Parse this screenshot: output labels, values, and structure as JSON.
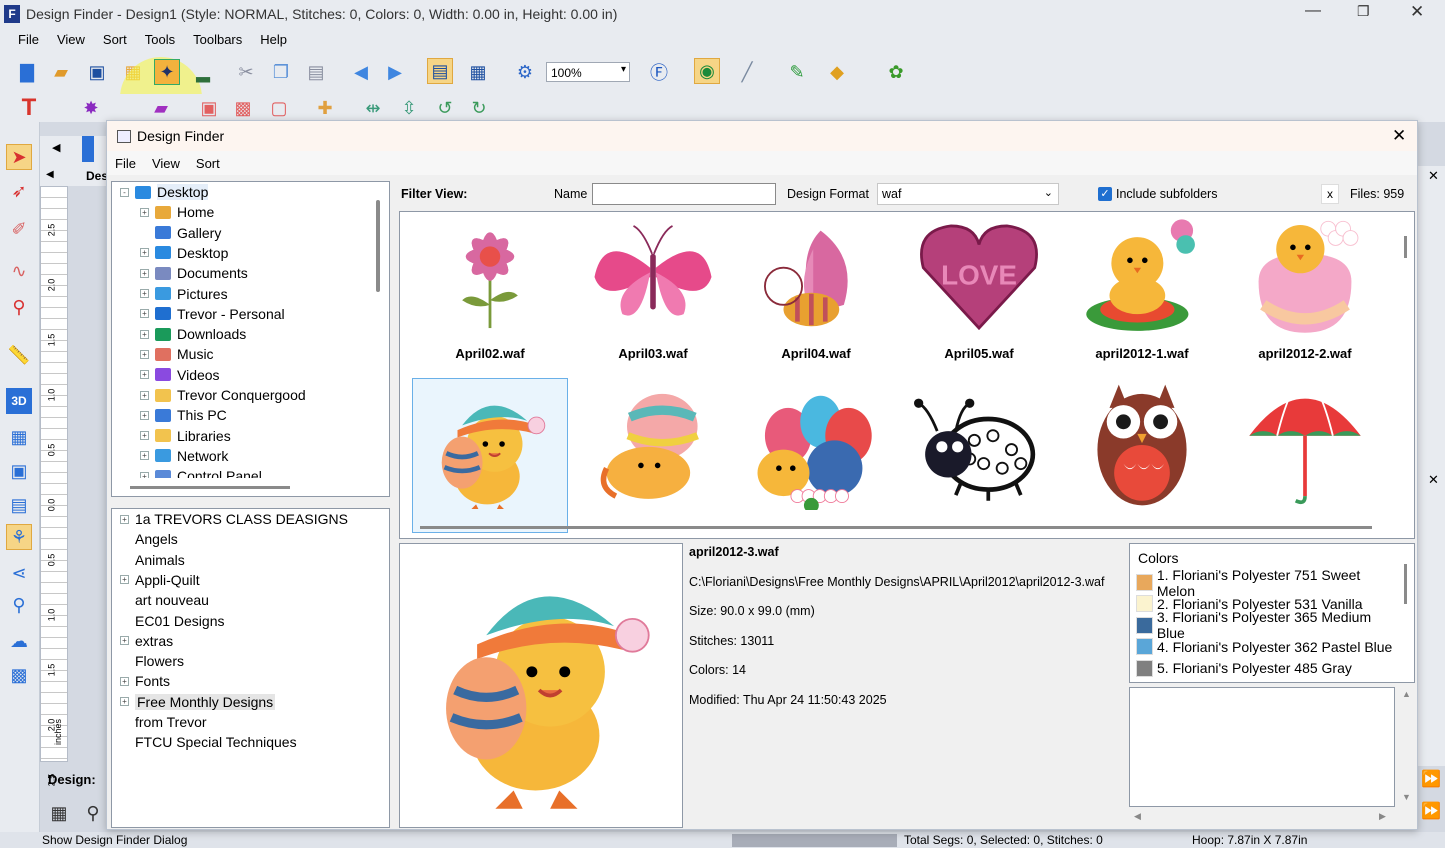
{
  "app": {
    "title": "Design Finder - Design1 (Style: NORMAL, Stitches: 0, Colors: 0, Width: 0.00 in, Height: 0.00 in)",
    "menu": [
      "File",
      "View",
      "Sort",
      "Tools",
      "Toolbars",
      "Help"
    ],
    "zoom": "100%",
    "design_label": "Design:",
    "tab_label": "Des",
    "status": {
      "left": "Show Design Finder Dialog",
      "middle": "Total Segs: 0, Selected: 0, Stitches: 0",
      "right": "Hoop: 7.87in X 7.87in"
    },
    "ruler": {
      "unit": "inches",
      "ticks": [
        "2.5",
        "2.0",
        "1.5",
        "1.0",
        "0.5",
        "0.0",
        "0.5",
        "1.0",
        "1.5",
        "2.0",
        "2.5"
      ]
    }
  },
  "dialog": {
    "title": "Design Finder",
    "menu": [
      "File",
      "View",
      "Sort"
    ],
    "filter": {
      "label": "Filter View:",
      "name_label": "Name",
      "name_value": "",
      "format_label": "Design Format",
      "format_value": "waf",
      "include_subfolders": "Include subfolders",
      "clear": "x",
      "files_count": "Files: 959"
    },
    "tree": [
      {
        "label": "Desktop",
        "level": 0,
        "expander": "-",
        "icon": "desktop-icon"
      },
      {
        "label": "Home",
        "level": 1,
        "expander": "+",
        "icon": "home-icon"
      },
      {
        "label": "Gallery",
        "level": 1,
        "expander": "",
        "icon": "gallery-icon"
      },
      {
        "label": "Desktop",
        "level": 1,
        "expander": "+",
        "icon": "desktop-icon"
      },
      {
        "label": "Documents",
        "level": 1,
        "expander": "+",
        "icon": "documents-icon"
      },
      {
        "label": "Pictures",
        "level": 1,
        "expander": "+",
        "icon": "pictures-icon"
      },
      {
        "label": "Trevor - Personal",
        "level": 1,
        "expander": "+",
        "icon": "cloud-icon"
      },
      {
        "label": "Downloads",
        "level": 1,
        "expander": "+",
        "icon": "downloads-icon"
      },
      {
        "label": "Music",
        "level": 1,
        "expander": "+",
        "icon": "music-icon"
      },
      {
        "label": "Videos",
        "level": 1,
        "expander": "+",
        "icon": "videos-icon"
      },
      {
        "label": "Trevor Conquergood",
        "level": 1,
        "expander": "+",
        "icon": "folder-icon"
      },
      {
        "label": "This PC",
        "level": 1,
        "expander": "+",
        "icon": "pc-icon"
      },
      {
        "label": "Libraries",
        "level": 1,
        "expander": "+",
        "icon": "folder-icon"
      },
      {
        "label": "Network",
        "level": 1,
        "expander": "+",
        "icon": "network-icon"
      },
      {
        "label": "Control Panel",
        "level": 1,
        "expander": "+",
        "icon": "control-panel-icon"
      }
    ],
    "folders": [
      {
        "label": "1a TREVORS CLASS DEASIGNS",
        "expander": "+"
      },
      {
        "label": "Angels",
        "expander": ""
      },
      {
        "label": "Animals",
        "expander": ""
      },
      {
        "label": "Appli-Quilt",
        "expander": "+"
      },
      {
        "label": "art nouveau",
        "expander": ""
      },
      {
        "label": "EC01 Designs",
        "expander": ""
      },
      {
        "label": "extras",
        "expander": "+"
      },
      {
        "label": "Flowers",
        "expander": ""
      },
      {
        "label": "Fonts",
        "expander": "+"
      },
      {
        "label": "Free Monthly Designs",
        "expander": "+",
        "selected": true
      },
      {
        "label": "from Trevor",
        "expander": ""
      },
      {
        "label": "FTCU Special Techniques",
        "expander": ""
      }
    ],
    "thumbnails": [
      {
        "name": "April02.waf",
        "art": "flower"
      },
      {
        "name": "April03.waf",
        "art": "butterfly"
      },
      {
        "name": "April04.waf",
        "art": "bee"
      },
      {
        "name": "April05.waf",
        "art": "heart"
      },
      {
        "name": "april2012-1.waf",
        "art": "chick-nest"
      },
      {
        "name": "april2012-2.waf",
        "art": "chick-egg"
      },
      {
        "name": "",
        "art": "chick-hat",
        "selected": true
      },
      {
        "name": "",
        "art": "chick-egg2"
      },
      {
        "name": "",
        "art": "eggs"
      },
      {
        "name": "",
        "art": "ladybug"
      },
      {
        "name": "",
        "art": "owl"
      },
      {
        "name": "",
        "art": "umbrella"
      }
    ],
    "details": {
      "filename": "april2012-3.waf",
      "path": "C:\\Floriani\\Designs\\Free Monthly Designs\\APRIL\\April2012\\april2012-3.waf",
      "size": "Size: 90.0 x 99.0 (mm)",
      "stitches": "Stitches: 13011",
      "colors": "Colors: 14",
      "modified": "Modified: Thu Apr 24 11:50:43 2025"
    },
    "colors_title": "Colors",
    "colors": [
      {
        "label": "1. Floriani's Polyester 751 Sweet Melon",
        "hex": "#e8a85c"
      },
      {
        "label": "2. Floriani's Polyester 531 Vanilla",
        "hex": "#fbf3cf"
      },
      {
        "label": "3. Floriani's Polyester 365 Medium Blue",
        "hex": "#3a6a9c"
      },
      {
        "label": "4. Floriani's Polyester 362 Pastel Blue",
        "hex": "#5aa6d8"
      },
      {
        "label": "5. Floriani's Polyester 485 Gray",
        "hex": "#808080"
      }
    ]
  }
}
